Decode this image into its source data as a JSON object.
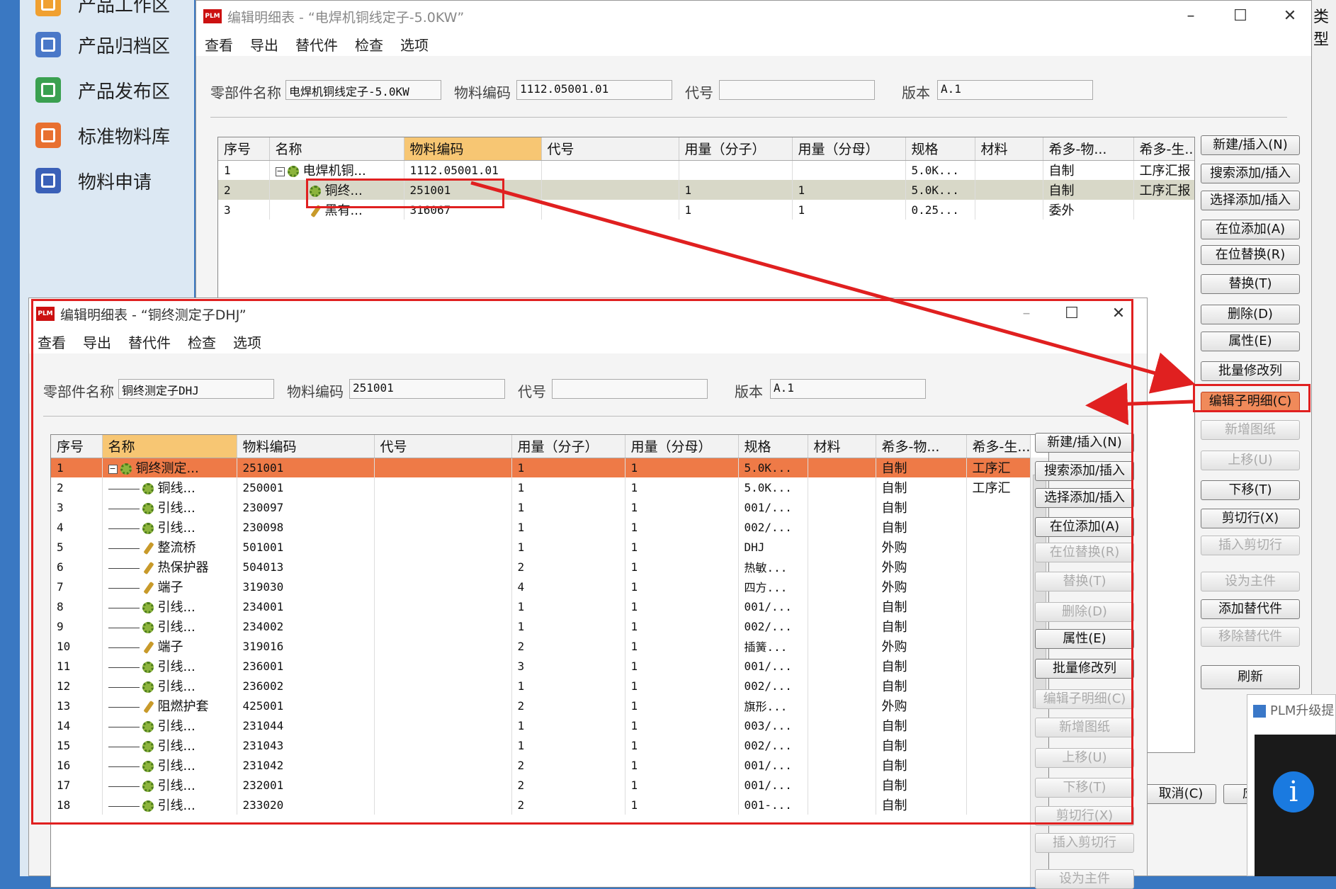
{
  "sidebar": {
    "items": [
      {
        "label": "产品工作区",
        "icon": "folder-icon",
        "color": "#f0a030"
      },
      {
        "label": "产品归档区",
        "icon": "archive-icon",
        "color": "#4a78c8"
      },
      {
        "label": "产品发布区",
        "icon": "upload-icon",
        "color": "#3aa050"
      },
      {
        "label": "标准物料库",
        "icon": "home-icon",
        "color": "#e87030"
      },
      {
        "label": "物料申请",
        "icon": "edit-icon",
        "color": "#3a60b8"
      }
    ]
  },
  "back_window": {
    "title": "编辑明细表 - “电焊机铜线定子-5.0KW”",
    "menu": [
      "查看",
      "导出",
      "替代件",
      "检查",
      "选项"
    ],
    "fields": {
      "part_name_label": "零部件名称",
      "part_name_value": "电焊机铜线定子-5.0KW",
      "code_label": "物料编码",
      "code_value": "1112.05001.01",
      "alias_label": "代号",
      "alias_value": "",
      "version_label": "版本",
      "version_value": "A.1"
    },
    "columns": [
      "序号",
      "名称",
      "物料编码",
      "代号",
      "用量（分子）",
      "用量（分母）",
      "规格",
      "材料",
      "希多-物...",
      "希多-生..."
    ],
    "rows": [
      {
        "seq": "1",
        "name": "电焊机铜...",
        "code": "1112.05001.01",
        "alias": "",
        "num": "",
        "den": "",
        "spec": "5.0K...",
        "mat": "",
        "src": "自制",
        "prod": "工序汇报"
      },
      {
        "seq": "2",
        "name": "铜终...",
        "code": "251001",
        "alias": "",
        "num": "1",
        "den": "1",
        "spec": "5.0K...",
        "mat": "",
        "src": "自制",
        "prod": "工序汇报"
      },
      {
        "seq": "3",
        "name": "黑有...",
        "code": "316067",
        "alias": "",
        "num": "1",
        "den": "1",
        "spec": "0.25...",
        "mat": "",
        "src": "委外",
        "prod": ""
      }
    ],
    "buttons": [
      "新建/插入(N)",
      "搜索添加/插入",
      "选择添加/插入",
      "在位添加(A)",
      "在位替换(R)",
      "替换(T)",
      "删除(D)",
      "属性(E)",
      "批量修改列",
      "编辑子明细(C)",
      "新增图纸",
      "上移(U)",
      "下移(T)",
      "剪切行(X)",
      "插入剪切行",
      "设为主件",
      "添加替代件",
      "移除替代件",
      "刷新"
    ],
    "bottom_buttons": [
      "取消(C)",
      "应用"
    ]
  },
  "front_window": {
    "title": "编辑明细表 - “铜终测定子DHJ”",
    "menu": [
      "查看",
      "导出",
      "替代件",
      "检查",
      "选项"
    ],
    "fields": {
      "part_name_label": "零部件名称",
      "part_name_value": "铜终测定子DHJ",
      "code_label": "物料编码",
      "code_value": "251001",
      "alias_label": "代号",
      "alias_value": "",
      "version_label": "版本",
      "version_value": "A.1"
    },
    "columns": [
      "序号",
      "名称",
      "物料编码",
      "代号",
      "用量（分子）",
      "用量（分母）",
      "规格",
      "材料",
      "希多-物...",
      "希多-生..."
    ],
    "rows": [
      {
        "seq": "1",
        "name": "铜终测定...",
        "code": "251001",
        "num": "1",
        "den": "1",
        "spec": "5.0K...",
        "src": "自制",
        "prod": "工序汇",
        "icon": "gear"
      },
      {
        "seq": "2",
        "name": "铜线...",
        "code": "250001",
        "num": "1",
        "den": "1",
        "spec": "5.0K...",
        "src": "自制",
        "prod": "工序汇",
        "icon": "gear"
      },
      {
        "seq": "3",
        "name": "引线...",
        "code": "230097",
        "num": "1",
        "den": "1",
        "spec": "001/...",
        "src": "自制",
        "prod": "",
        "icon": "gear"
      },
      {
        "seq": "4",
        "name": "引线...",
        "code": "230098",
        "num": "1",
        "den": "1",
        "spec": "002/...",
        "src": "自制",
        "prod": "",
        "icon": "gear"
      },
      {
        "seq": "5",
        "name": "整流桥",
        "code": "501001",
        "num": "1",
        "den": "1",
        "spec": "DHJ",
        "src": "外购",
        "prod": "",
        "icon": "wrench"
      },
      {
        "seq": "6",
        "name": "热保护器",
        "code": "504013",
        "num": "2",
        "den": "1",
        "spec": "热敏...",
        "src": "外购",
        "prod": "",
        "icon": "wrench"
      },
      {
        "seq": "7",
        "name": "端子",
        "code": "319030",
        "num": "4",
        "den": "1",
        "spec": "四方...",
        "src": "外购",
        "prod": "",
        "icon": "wrench"
      },
      {
        "seq": "8",
        "name": "引线...",
        "code": "234001",
        "num": "1",
        "den": "1",
        "spec": "001/...",
        "src": "自制",
        "prod": "",
        "icon": "gear"
      },
      {
        "seq": "9",
        "name": "引线...",
        "code": "234002",
        "num": "1",
        "den": "1",
        "spec": "002/...",
        "src": "自制",
        "prod": "",
        "icon": "gear"
      },
      {
        "seq": "10",
        "name": "端子",
        "code": "319016",
        "num": "2",
        "den": "1",
        "spec": "插簧...",
        "src": "外购",
        "prod": "",
        "icon": "wrench"
      },
      {
        "seq": "11",
        "name": "引线...",
        "code": "236001",
        "num": "3",
        "den": "1",
        "spec": "001/...",
        "src": "自制",
        "prod": "",
        "icon": "gear"
      },
      {
        "seq": "12",
        "name": "引线...",
        "code": "236002",
        "num": "1",
        "den": "1",
        "spec": "002/...",
        "src": "自制",
        "prod": "",
        "icon": "gear"
      },
      {
        "seq": "13",
        "name": "阻燃护套",
        "code": "425001",
        "num": "2",
        "den": "1",
        "spec": "旗形...",
        "src": "外购",
        "prod": "",
        "icon": "wrench"
      },
      {
        "seq": "14",
        "name": "引线...",
        "code": "231044",
        "num": "1",
        "den": "1",
        "spec": "003/...",
        "src": "自制",
        "prod": "",
        "icon": "gear"
      },
      {
        "seq": "15",
        "name": "引线...",
        "code": "231043",
        "num": "1",
        "den": "1",
        "spec": "002/...",
        "src": "自制",
        "prod": "",
        "icon": "gear"
      },
      {
        "seq": "16",
        "name": "引线...",
        "code": "231042",
        "num": "2",
        "den": "1",
        "spec": "001/...",
        "src": "自制",
        "prod": "",
        "icon": "gear"
      },
      {
        "seq": "17",
        "name": "引线...",
        "code": "232001",
        "num": "2",
        "den": "1",
        "spec": "001/...",
        "src": "自制",
        "prod": "",
        "icon": "gear"
      },
      {
        "seq": "18",
        "name": "引线...",
        "code": "233020",
        "num": "2",
        "den": "1",
        "spec": "001-...",
        "src": "自制",
        "prod": "",
        "icon": "gear"
      }
    ],
    "buttons": [
      "新建/插入(N)",
      "搜索添加/插入",
      "选择添加/插入",
      "在位添加(A)",
      "在位替换(R)",
      "替换(T)",
      "删除(D)",
      "属性(E)",
      "批量修改列",
      "编辑子明细(C)",
      "新增图纸",
      "上移(U)",
      "下移(T)",
      "剪切行(X)",
      "插入剪切行",
      "设为主件"
    ]
  },
  "notification": {
    "title": "PLM升级提"
  },
  "right_edge_text": "类型"
}
